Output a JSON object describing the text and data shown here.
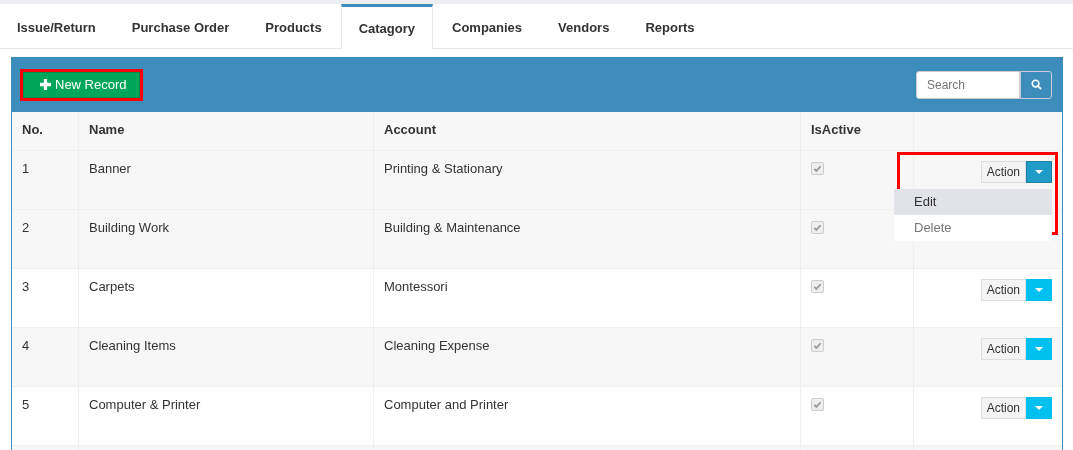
{
  "tabs": [
    {
      "label": "Issue/Return",
      "selected": false
    },
    {
      "label": "Purchase Order",
      "selected": false
    },
    {
      "label": "Products",
      "selected": false
    },
    {
      "label": "Catagory",
      "selected": true
    },
    {
      "label": "Companies",
      "selected": false
    },
    {
      "label": "Vendors",
      "selected": false
    },
    {
      "label": "Reports",
      "selected": false
    }
  ],
  "toolbar": {
    "new_button": "New Record",
    "search": {
      "placeholder": "Search"
    }
  },
  "table": {
    "columns": [
      "No.",
      "Name",
      "Account",
      "IsActive"
    ],
    "rows": [
      {
        "no": "1",
        "name": "Banner",
        "account": "Printing & Stationary",
        "active": true,
        "action": "Action",
        "menu": [
          {
            "label": "Edit",
            "selected": true
          },
          {
            "label": "Delete",
            "selected": false
          }
        ]
      },
      {
        "no": "2",
        "name": "Building Work",
        "account": "Building & Maintenance",
        "active": true
      },
      {
        "no": "3",
        "name": "Carpets",
        "account": "Montessori",
        "active": true,
        "action": "Action"
      },
      {
        "no": "4",
        "name": "Cleaning Items",
        "account": "Cleaning Expense",
        "active": true,
        "action": "Action"
      },
      {
        "no": "5",
        "name": "Computer & Printer",
        "account": "Computer and Printer",
        "active": true,
        "action": "Action"
      }
    ]
  }
}
